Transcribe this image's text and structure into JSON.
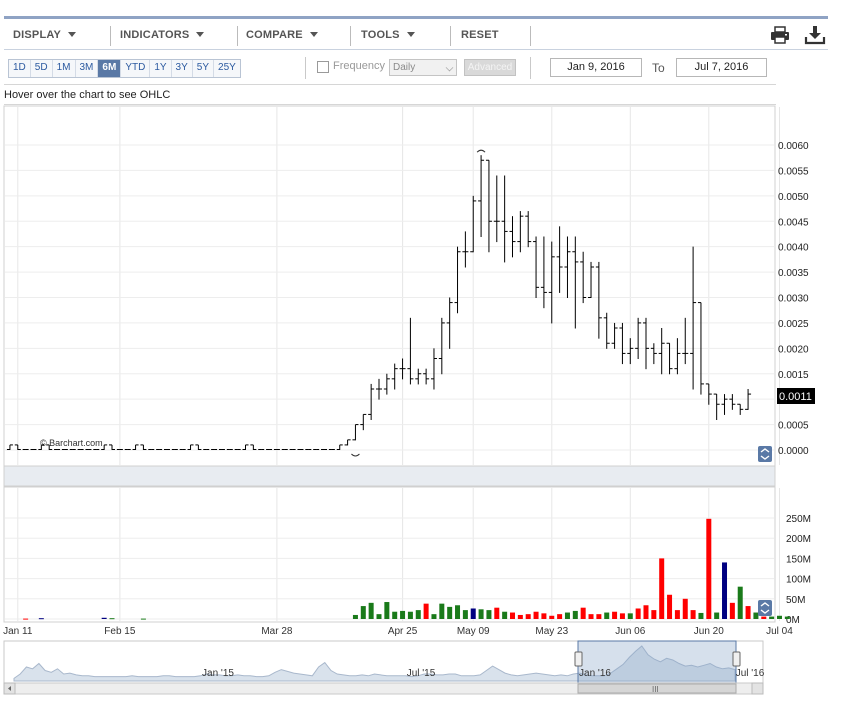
{
  "toolbar": {
    "menus": [
      "DISPLAY",
      "INDICATORS",
      "COMPARE",
      "TOOLS",
      "RESET"
    ],
    "print_icon": "printer-icon",
    "download_icon": "download-icon"
  },
  "range_buttons": [
    "1D",
    "5D",
    "1M",
    "3M",
    "6M",
    "YTD",
    "1Y",
    "3Y",
    "5Y",
    "25Y"
  ],
  "range_active": "6M",
  "frequency": {
    "label": "Frequency",
    "value": "Daily",
    "advanced_label": "Advanced"
  },
  "date_range": {
    "from": "Jan 9, 2016",
    "to_label": "To",
    "to": "Jul 7, 2016"
  },
  "hover_text": "Hover over the chart to see OHLC",
  "watermark": "© Barchart.com",
  "colors": {
    "up": "#1a7a1a",
    "down": "#ff0000",
    "neutral": "#000080",
    "price_bar": "#000000",
    "navigator_fill": "#b8c8dc"
  },
  "chart_data": {
    "type": "ohlc_bar_with_volume",
    "x_ticks": [
      "Jan 11",
      "Feb 15",
      "Mar 28",
      "Apr 25",
      "May 09",
      "May 23",
      "Jun 06",
      "Jun 20",
      "Jul 04"
    ],
    "x_tick_index": [
      1,
      14,
      34,
      50,
      59,
      69,
      79,
      89,
      98
    ],
    "price_axis": {
      "ticks": [
        "0.0060",
        "0.0055",
        "0.0050",
        "0.0045",
        "0.0040",
        "0.0035",
        "0.0030",
        "0.0025",
        "0.0020",
        "0.0015",
        "0.0010",
        "0.0005",
        "0.0000"
      ],
      "ylim": [
        -3e-05,
        0.0063
      ]
    },
    "last_price_label": "0.0011",
    "last_price": 0.0011,
    "volume_axis": {
      "ticks": [
        "250M",
        "200M",
        "150M",
        "100M",
        "50M",
        "0M"
      ],
      "values": [
        250,
        200,
        150,
        100,
        50,
        0
      ],
      "ylim": [
        0,
        265
      ]
    },
    "ohlc": [
      [
        1e-05,
        0.0001,
        1e-05,
        0.0001
      ],
      [
        0.0001,
        0.0001,
        1e-05,
        1e-05
      ],
      [
        1e-05,
        1e-05,
        1e-05,
        1e-05
      ],
      [
        1e-05,
        1e-05,
        1e-05,
        1e-05
      ],
      [
        1e-05,
        0.0001,
        1e-05,
        0.0001
      ],
      [
        0.0001,
        0.0001,
        1e-05,
        1e-05
      ],
      [
        1e-05,
        1e-05,
        1e-05,
        1e-05
      ],
      [
        1e-05,
        1e-05,
        1e-05,
        1e-05
      ],
      [
        1e-05,
        1e-05,
        1e-05,
        1e-05
      ],
      [
        1e-05,
        1e-05,
        1e-05,
        1e-05
      ],
      [
        1e-05,
        1e-05,
        1e-05,
        1e-05
      ],
      [
        1e-05,
        1e-05,
        1e-05,
        1e-05
      ],
      [
        1e-05,
        0.0001,
        1e-05,
        0.0001
      ],
      [
        0.0001,
        0.0001,
        1e-05,
        1e-05
      ],
      [
        1e-05,
        1e-05,
        1e-05,
        1e-05
      ],
      [
        1e-05,
        1e-05,
        1e-05,
        1e-05
      ],
      [
        1e-05,
        0.0001,
        1e-05,
        0.0001
      ],
      [
        0.0001,
        0.0001,
        1e-05,
        1e-05
      ],
      [
        1e-05,
        1e-05,
        1e-05,
        1e-05
      ],
      [
        1e-05,
        1e-05,
        1e-05,
        1e-05
      ],
      [
        1e-05,
        1e-05,
        1e-05,
        1e-05
      ],
      [
        1e-05,
        1e-05,
        1e-05,
        1e-05
      ],
      [
        1e-05,
        1e-05,
        1e-05,
        1e-05
      ],
      [
        1e-05,
        0.0001,
        1e-05,
        0.0001
      ],
      [
        0.0001,
        0.0001,
        1e-05,
        1e-05
      ],
      [
        1e-05,
        1e-05,
        1e-05,
        1e-05
      ],
      [
        1e-05,
        1e-05,
        1e-05,
        1e-05
      ],
      [
        1e-05,
        1e-05,
        1e-05,
        1e-05
      ],
      [
        1e-05,
        1e-05,
        1e-05,
        1e-05
      ],
      [
        1e-05,
        1e-05,
        1e-05,
        1e-05
      ],
      [
        1e-05,
        0.0001,
        1e-05,
        0.0001
      ],
      [
        0.0001,
        0.0001,
        1e-05,
        1e-05
      ],
      [
        1e-05,
        1e-05,
        1e-05,
        1e-05
      ],
      [
        1e-05,
        1e-05,
        1e-05,
        1e-05
      ],
      [
        1e-05,
        1e-05,
        1e-05,
        1e-05
      ],
      [
        1e-05,
        1e-05,
        1e-05,
        1e-05
      ],
      [
        1e-05,
        1e-05,
        1e-05,
        1e-05
      ],
      [
        1e-05,
        1e-05,
        1e-05,
        1e-05
      ],
      [
        1e-05,
        1e-05,
        1e-05,
        1e-05
      ],
      [
        1e-05,
        1e-05,
        1e-05,
        1e-05
      ],
      [
        1e-05,
        1e-05,
        1e-05,
        1e-05
      ],
      [
        1e-05,
        1e-05,
        1e-05,
        1e-05
      ],
      [
        1e-05,
        0.0001,
        1e-05,
        0.0001
      ],
      [
        0.0001,
        0.0002,
        0.0001,
        0.0002
      ],
      [
        0.0002,
        0.0005,
        0.0002,
        0.0005
      ],
      [
        0.0005,
        0.0007,
        0.0004,
        0.0007
      ],
      [
        0.0007,
        0.0013,
        0.0006,
        0.0012
      ],
      [
        0.0012,
        0.0014,
        0.001,
        0.0012
      ],
      [
        0.0012,
        0.0015,
        0.0011,
        0.0014
      ],
      [
        0.0014,
        0.0017,
        0.0012,
        0.0016
      ],
      [
        0.0016,
        0.0018,
        0.0014,
        0.0016
      ],
      [
        0.0016,
        0.0026,
        0.0013,
        0.0014
      ],
      [
        0.0014,
        0.0016,
        0.0013,
        0.0015
      ],
      [
        0.0015,
        0.0016,
        0.0013,
        0.0014
      ],
      [
        0.0014,
        0.002,
        0.0012,
        0.0018
      ],
      [
        0.0018,
        0.0026,
        0.0015,
        0.0025
      ],
      [
        0.0025,
        0.003,
        0.002,
        0.0029
      ],
      [
        0.0029,
        0.004,
        0.0027,
        0.0039
      ],
      [
        0.0039,
        0.0043,
        0.0036,
        0.0039
      ],
      [
        0.0039,
        0.005,
        0.0039,
        0.0049
      ],
      [
        0.0049,
        0.0058,
        0.0042,
        0.0057
      ],
      [
        0.0057,
        0.0056,
        0.0039,
        0.0045
      ],
      [
        0.0045,
        0.0054,
        0.0041,
        0.0045
      ],
      [
        0.0045,
        0.0054,
        0.0037,
        0.0043
      ],
      [
        0.0043,
        0.0046,
        0.0038,
        0.0041
      ],
      [
        0.0041,
        0.0047,
        0.0039,
        0.0046
      ],
      [
        0.0046,
        0.0047,
        0.004,
        0.0041
      ],
      [
        0.0041,
        0.0042,
        0.003,
        0.0032
      ],
      [
        0.0032,
        0.0042,
        0.0028,
        0.0031
      ],
      [
        0.0031,
        0.0041,
        0.0025,
        0.0038
      ],
      [
        0.0038,
        0.0044,
        0.0031,
        0.0036
      ],
      [
        0.0036,
        0.0042,
        0.003,
        0.0039
      ],
      [
        0.0039,
        0.0042,
        0.0024,
        0.0037
      ],
      [
        0.0037,
        0.0039,
        0.0029,
        0.003
      ],
      [
        0.003,
        0.0037,
        0.003,
        0.0036
      ],
      [
        0.0036,
        0.0037,
        0.0022,
        0.0026
      ],
      [
        0.0026,
        0.0027,
        0.002,
        0.0021
      ],
      [
        0.0021,
        0.0025,
        0.002,
        0.0024
      ],
      [
        0.0024,
        0.0025,
        0.0017,
        0.0019
      ],
      [
        0.0019,
        0.0022,
        0.0017,
        0.002
      ],
      [
        0.002,
        0.0026,
        0.0018,
        0.0025
      ],
      [
        0.0025,
        0.0026,
        0.0016,
        0.002
      ],
      [
        0.002,
        0.0021,
        0.0017,
        0.0019
      ],
      [
        0.0019,
        0.0024,
        0.0015,
        0.0021
      ],
      [
        0.0021,
        0.0021,
        0.0015,
        0.0016
      ],
      [
        0.0016,
        0.0022,
        0.0015,
        0.0019
      ],
      [
        0.0019,
        0.0026,
        0.0017,
        0.0019
      ],
      [
        0.0019,
        0.004,
        0.0012,
        0.0029
      ],
      [
        0.0029,
        0.0014,
        0.0011,
        0.0013
      ],
      [
        0.0013,
        0.0013,
        0.0009,
        0.0011
      ],
      [
        0.0011,
        0.0011,
        0.0006,
        0.0009
      ],
      [
        0.0009,
        0.0011,
        0.0007,
        0.001
      ],
      [
        0.001,
        0.0011,
        0.0008,
        0.0009
      ],
      [
        0.0009,
        0.0009,
        0.0007,
        0.0008
      ],
      [
        0.0008,
        0.0012,
        0.0008,
        0.0011
      ]
    ],
    "volume_millions": [
      0,
      0,
      1,
      0,
      2,
      0,
      0,
      0,
      0,
      0,
      0,
      0,
      3,
      2,
      0,
      0,
      0,
      1,
      0,
      0,
      0,
      0,
      0,
      0,
      0,
      0,
      0,
      0,
      0,
      0,
      0,
      0,
      0,
      0,
      0,
      0,
      0,
      0,
      0,
      0,
      0,
      0,
      0,
      0,
      10,
      32,
      40,
      12,
      42,
      18,
      20,
      18,
      22,
      38,
      12,
      38,
      30,
      34,
      22,
      26,
      24,
      22,
      28,
      18,
      16,
      10,
      12,
      18,
      14,
      8,
      12,
      16,
      20,
      28,
      12,
      12,
      16,
      18,
      14,
      14,
      26,
      34,
      22,
      150,
      60,
      22,
      50,
      22,
      15,
      248,
      16,
      140,
      40,
      80,
      32,
      16,
      6,
      6,
      8,
      6
    ],
    "volume_color": [
      "d",
      "d",
      "d",
      "d",
      "n",
      "d",
      "d",
      "d",
      "d",
      "d",
      "d",
      "d",
      "n",
      "u",
      "d",
      "d",
      "d",
      "u",
      "d",
      "d",
      "d",
      "d",
      "d",
      "d",
      "d",
      "d",
      "d",
      "d",
      "d",
      "d",
      "d",
      "d",
      "d",
      "d",
      "d",
      "d",
      "d",
      "d",
      "d",
      "d",
      "d",
      "d",
      "d",
      "d",
      "u",
      "u",
      "u",
      "u",
      "u",
      "u",
      "u",
      "u",
      "u",
      "d",
      "u",
      "u",
      "u",
      "u",
      "u",
      "n",
      "u",
      "u",
      "d",
      "u",
      "d",
      "d",
      "d",
      "d",
      "d",
      "d",
      "d",
      "u",
      "u",
      "d",
      "d",
      "d",
      "u",
      "d",
      "d",
      "u",
      "d",
      "d",
      "d",
      "d",
      "d",
      "d",
      "d",
      "d",
      "u",
      "d",
      "u",
      "n",
      "d",
      "u",
      "d",
      "u",
      "d",
      "u",
      "u",
      "u"
    ],
    "navigator": {
      "ticks": [
        "Jan '15",
        "Jul '15",
        "Jan '16",
        "Jul '16"
      ],
      "series": [
        3,
        8,
        16,
        14,
        20,
        12,
        10,
        14,
        8,
        9,
        7,
        6,
        6,
        5,
        5,
        5,
        5,
        5,
        5,
        6,
        5,
        5,
        5,
        5,
        6,
        6,
        5,
        5,
        5,
        5,
        6,
        8,
        7,
        7,
        6,
        6,
        7,
        6,
        6,
        5,
        5,
        6,
        10,
        13,
        11,
        9,
        8,
        7,
        6,
        16,
        21,
        12,
        8,
        7,
        6,
        6,
        7,
        6,
        8,
        7,
        6,
        6,
        6,
        6,
        5,
        6,
        8,
        8,
        7,
        7,
        8,
        8,
        6,
        6,
        6,
        7,
        12,
        17,
        13,
        9,
        7,
        6,
        7,
        8,
        9,
        8,
        7,
        6,
        7,
        6,
        8,
        9,
        7,
        6,
        6,
        6,
        9,
        14,
        19,
        27,
        34,
        40,
        30,
        25,
        22,
        26,
        24,
        20,
        17,
        18,
        16,
        18,
        20,
        16,
        14,
        15,
        13
      ]
    }
  }
}
